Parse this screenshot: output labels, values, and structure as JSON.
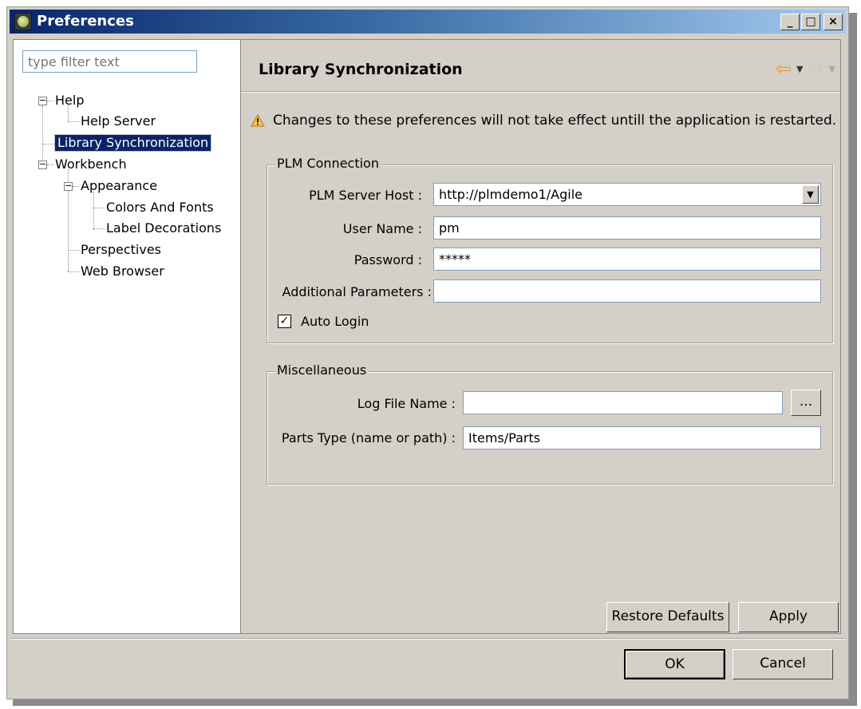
{
  "window": {
    "title": "Preferences"
  },
  "filter": {
    "placeholder": "type filter text"
  },
  "tree": {
    "help": "Help",
    "help_server": "Help Server",
    "library_sync": "Library Synchronization",
    "workbench": "Workbench",
    "appearance": "Appearance",
    "colors_fonts": "Colors And Fonts",
    "label_decorations": "Label Decorations",
    "perspectives": "Perspectives",
    "web_browser": "Web Browser"
  },
  "page": {
    "title": "Library Synchronization",
    "warning": "Changes to these preferences will not take effect untill the application is restarted."
  },
  "plm": {
    "group_label": "PLM Connection",
    "host_label": "PLM Server Host :",
    "host_value": "http://plmdemo1/Agile",
    "user_label": "User Name :",
    "user_value": "pm",
    "password_label": "Password :",
    "password_value": "*****",
    "params_label": "Additional Parameters :",
    "params_value": "",
    "auto_login_label": "Auto Login",
    "auto_login_checked": true
  },
  "misc": {
    "group_label": "Miscellaneous",
    "log_label": "Log File Name :",
    "log_value": "",
    "browse_label": "...",
    "parts_label": "Parts Type (name or path) :",
    "parts_value": "Items/Parts"
  },
  "buttons": {
    "restore": "Restore Defaults",
    "apply": "Apply",
    "ok": "OK",
    "cancel": "Cancel"
  },
  "titlebar_buttons": {
    "minimize": "_",
    "maximize": "□",
    "close": "×"
  }
}
